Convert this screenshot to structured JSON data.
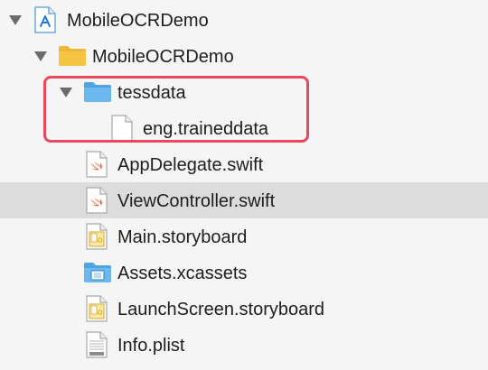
{
  "project": {
    "name": "MobileOCRDemo"
  },
  "group": {
    "name": "MobileOCRDemo"
  },
  "folder": {
    "name": "tessdata"
  },
  "files": {
    "traineddata": "eng.traineddata",
    "app_delegate": "AppDelegate.swift",
    "view_controller": "ViewController.swift",
    "main_storyboard": "Main.storyboard",
    "assets": "Assets.xcassets",
    "launch_screen": "LaunchScreen.storyboard",
    "info_plist": "Info.plist"
  },
  "icons": {
    "project": "xcode-project-icon",
    "group": "folder-icon",
    "folder": "blue-folder-icon",
    "plain_file": "document-icon",
    "swift_file": "swift-file-icon",
    "storyboard": "storyboard-icon",
    "asset_catalog": "asset-catalog-icon",
    "plist": "plist-icon"
  },
  "colors": {
    "background": "#f5f5f5",
    "selection": "#dcdcdc",
    "highlight": "#e8475c",
    "swift": "#f0562f",
    "folder_yellow": "#f5c542",
    "folder_blue": "#6cb8f0"
  }
}
